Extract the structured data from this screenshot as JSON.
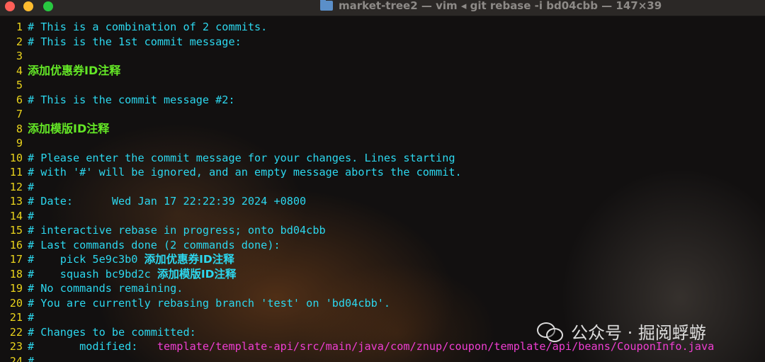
{
  "window": {
    "title": "market-tree2 — vim ◂ git rebase -i bd04cbb — 147×39"
  },
  "lines": [
    {
      "num": "1",
      "text": "# This is a combination of 2 commits.",
      "style": "comment"
    },
    {
      "num": "2",
      "text": "# This is the 1st commit message:",
      "style": "comment"
    },
    {
      "num": "3",
      "text": "",
      "style": "comment"
    },
    {
      "num": "4",
      "text": "添加优惠券ID注释",
      "style": "message"
    },
    {
      "num": "5",
      "text": "",
      "style": "comment"
    },
    {
      "num": "6",
      "text": "# This is the commit message #2:",
      "style": "comment"
    },
    {
      "num": "7",
      "text": "",
      "style": "comment"
    },
    {
      "num": "8",
      "text": "添加模版ID注释",
      "style": "message"
    },
    {
      "num": "9",
      "text": "",
      "style": "comment"
    },
    {
      "num": "10",
      "text": "# Please enter the commit message for your changes. Lines starting",
      "style": "comment"
    },
    {
      "num": "11",
      "text": "# with '#' will be ignored, and an empty message aborts the commit.",
      "style": "comment"
    },
    {
      "num": "12",
      "text": "#",
      "style": "comment"
    },
    {
      "num": "13",
      "text": "# Date:      Wed Jan 17 22:22:39 2024 +0800",
      "style": "comment"
    },
    {
      "num": "14",
      "text": "#",
      "style": "comment"
    },
    {
      "num": "15",
      "text": "# interactive rebase in progress; onto bd04cbb",
      "style": "comment"
    },
    {
      "num": "16",
      "text": "# Last commands done (2 commands done):",
      "style": "comment"
    },
    {
      "num": "17",
      "text": "#    pick 5e9c3b0 ",
      "cjk": "添加优惠券ID注释",
      "style": "mixed"
    },
    {
      "num": "18",
      "text": "#    squash bc9bd2c ",
      "cjk": "添加模版ID注释",
      "style": "mixed"
    },
    {
      "num": "19",
      "text": "# No commands remaining.",
      "style": "comment"
    },
    {
      "num": "20",
      "text": "# You are currently rebasing branch 'test' on 'bd04cbb'.",
      "style": "comment"
    },
    {
      "num": "21",
      "text": "#",
      "style": "comment"
    },
    {
      "num": "22",
      "text": "# Changes to be committed:",
      "style": "comment"
    },
    {
      "num": "23",
      "text": "#       modified:   ",
      "path": "template/template-api/src/main/java/com/znup/coupon/template/api/beans/CouponInfo.java",
      "style": "path"
    },
    {
      "num": "24",
      "text": "#",
      "style": "comment"
    }
  ],
  "watermark": {
    "text": "公众号 · 掘阅蜉蝣",
    "icon": "wechat-icon"
  },
  "colors": {
    "line_number": "#e9d31c",
    "comment": "#2cd7ee",
    "message": "#64e826",
    "path": "#ef3ed2"
  }
}
